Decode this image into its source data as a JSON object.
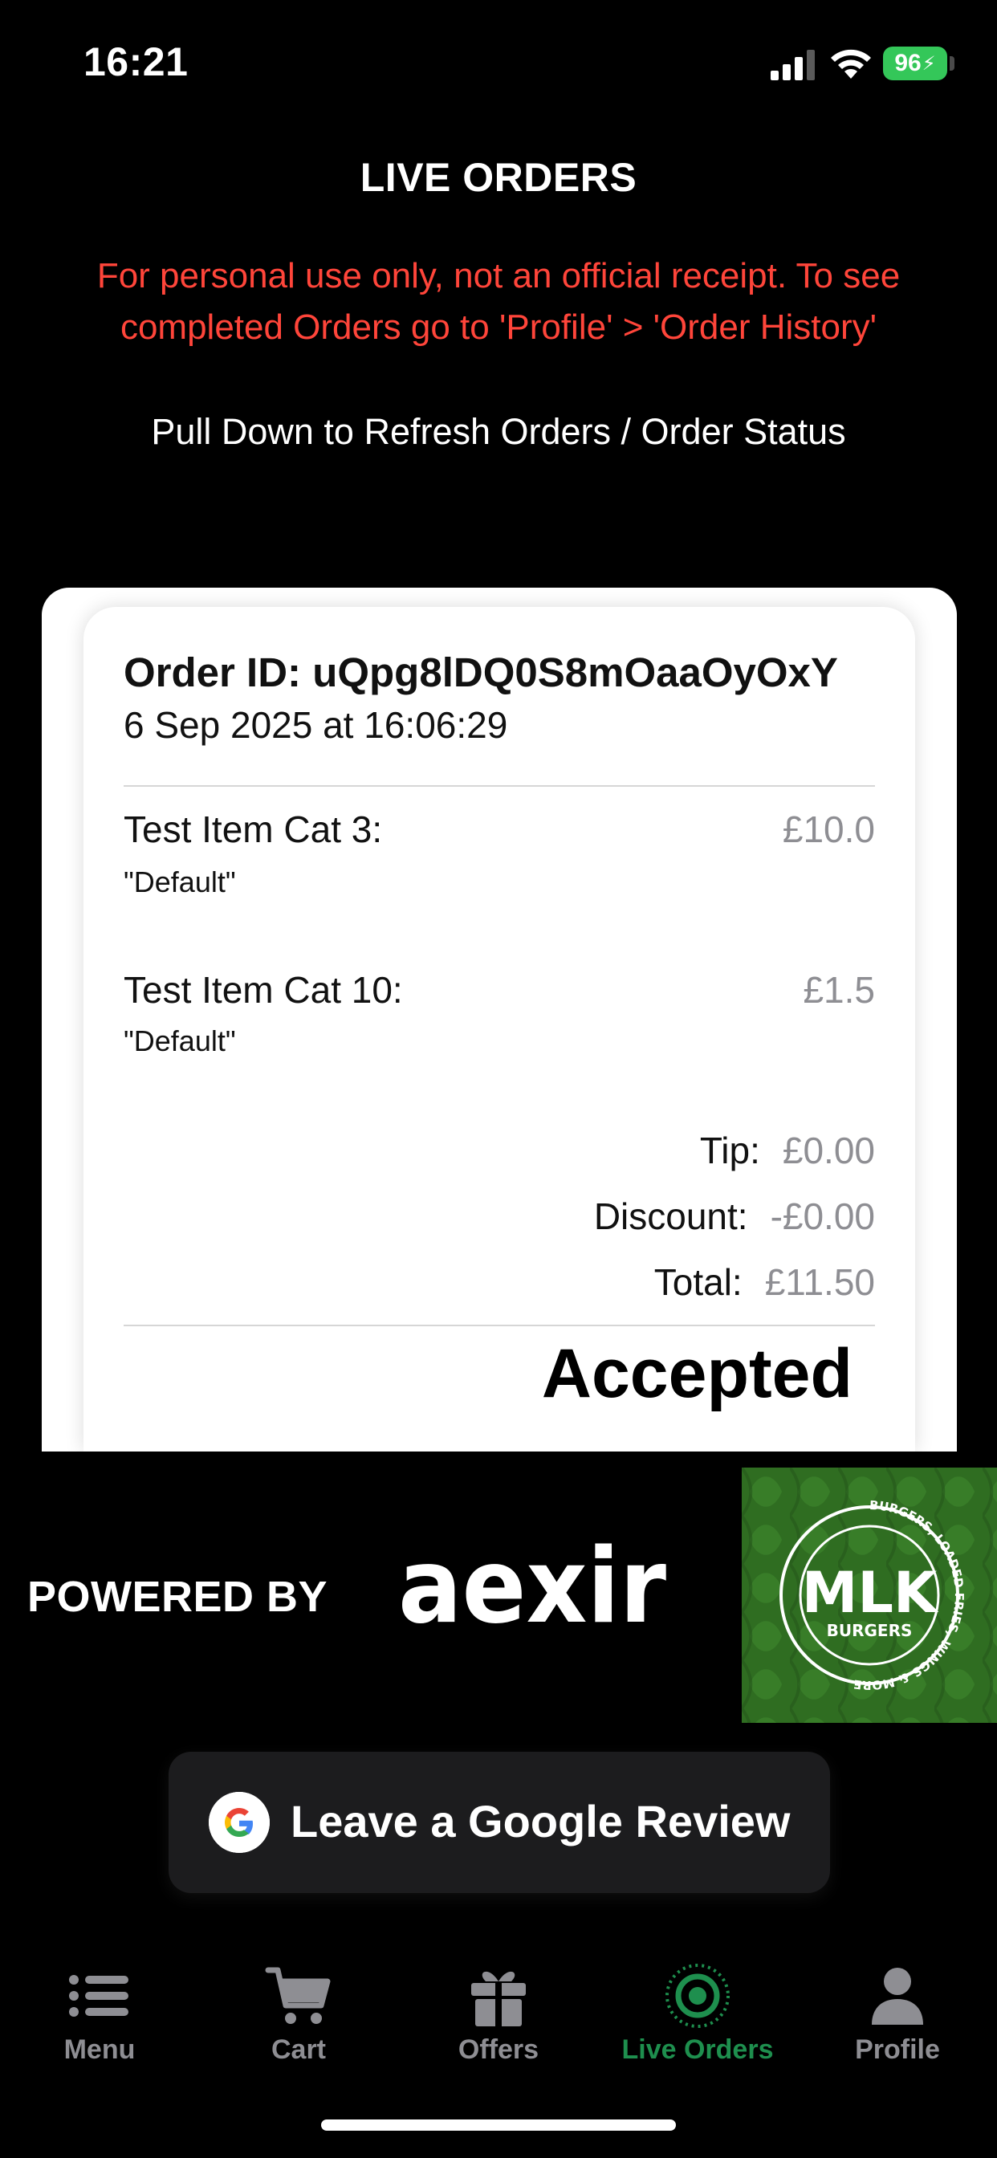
{
  "status_bar": {
    "time": "16:21",
    "battery": "96",
    "colors": {
      "battery": "#34c759"
    }
  },
  "header": {
    "title": "LIVE ORDERS",
    "disclaimer": "For personal use only, not an official receipt. To see completed Orders go to 'Profile' > 'Order History'",
    "refresh_hint": "Pull Down to Refresh Orders / Order Status"
  },
  "order": {
    "id_text": "Order ID: uQpg8lDQ0S8mOaaOyOxY",
    "date": "6 Sep 2025 at 16:06:29",
    "items": [
      {
        "name": "Test Item Cat 3:",
        "option": "\"Default\"",
        "price": "£10.0"
      },
      {
        "name": "Test Item Cat 10:",
        "option": "\"Default\"",
        "price": "£1.5"
      }
    ],
    "summary": {
      "tip_label": "Tip:",
      "tip_value": "£0.00",
      "discount_label": "Discount:",
      "discount_value": "-£0.00",
      "total_label": "Total:",
      "total_value": "£11.50"
    },
    "status": "Accepted"
  },
  "branding": {
    "powered_by": "POWERED BY",
    "aexir_logo": "aexir",
    "mlk_logo": {
      "main": "MLK",
      "sub": "BURGERS",
      "ring_text": "BURGERS, LOADED FRIES, WINGS & MORE"
    }
  },
  "review_button": {
    "label": "Leave a Google Review"
  },
  "tab_bar": {
    "tabs": [
      {
        "label": "Menu",
        "icon": "list-icon"
      },
      {
        "label": "Cart",
        "icon": "cart-icon"
      },
      {
        "label": "Offers",
        "icon": "gift-icon"
      },
      {
        "label": "Live Orders",
        "icon": "live-target-icon",
        "active": true
      },
      {
        "label": "Profile",
        "icon": "person-icon"
      }
    ],
    "colors": {
      "active": "#1e8f4e",
      "inactive": "#8e8e93"
    }
  },
  "colors": {
    "disclaimer": "#ff453a",
    "background": "#000000"
  }
}
